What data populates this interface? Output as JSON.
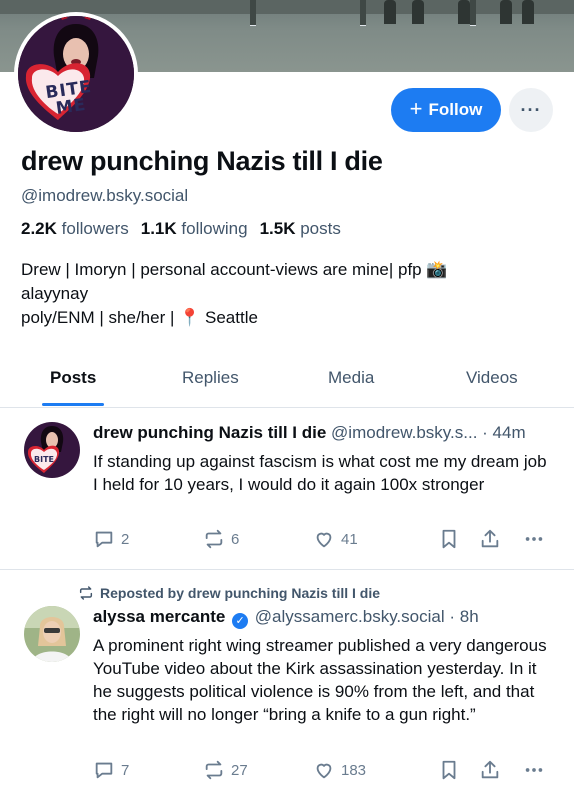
{
  "profile": {
    "display_name": "drew punching Nazis till I die",
    "handle": "@imodrew.bsky.social",
    "followers_count": "2.2K",
    "followers_label": "followers",
    "following_count": "1.1K",
    "following_label": "following",
    "posts_count": "1.5K",
    "posts_label": "posts",
    "bio_line1": "Drew | Imoryn | personal account-views are mine| pfp 📸",
    "bio_line2": "alayynay",
    "bio_line3": "poly/ENM | she/her | 📍 Seattle",
    "avatar_text": "BITE ME"
  },
  "actions": {
    "follow_icon": "+",
    "follow_label": "Follow",
    "more_label": "···"
  },
  "tabs": [
    {
      "label": "Posts",
      "active": true
    },
    {
      "label": "Replies",
      "active": false
    },
    {
      "label": "Media",
      "active": false
    },
    {
      "label": "Videos",
      "active": false
    }
  ],
  "posts": [
    {
      "author": "drew punching Nazis till I die",
      "handle": "@imodrew.bsky.s...",
      "time": "· 44m",
      "text": "If standing up against fascism is what cost me my dream job I held for 10 years, I would do it again 100x stronger",
      "replies": "2",
      "reposts": "6",
      "likes": "41"
    },
    {
      "repost_label": "Reposted by drew punching Nazis till I die",
      "author": "alyssa mercante",
      "verified_icon": "✓",
      "handle": "@alyssamerc.bsky.social",
      "time": "· 8h",
      "text": "A prominent right wing streamer published a very dangerous YouTube video about the Kirk assassination yesterday. In it he suggests political violence is 90% from the left, and that the right will no longer “bring a knife to a gun right.”",
      "replies": "7",
      "reposts": "27",
      "likes": "183"
    }
  ],
  "colors": {
    "accent": "#1d7cf2",
    "muted": "#42566b",
    "icon": "#6a7c8f"
  }
}
